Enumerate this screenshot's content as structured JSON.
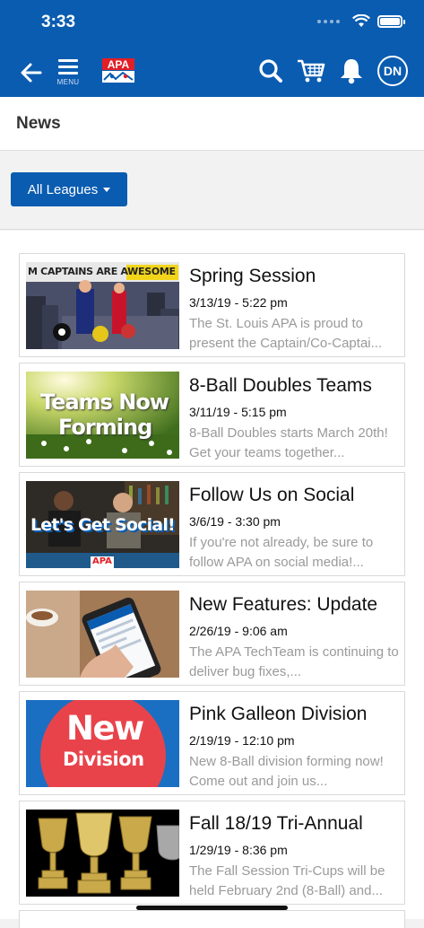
{
  "status": {
    "time": "3:33"
  },
  "nav": {
    "menu_label": "MENU",
    "logo_text": "APA",
    "avatar_initials": "DN"
  },
  "page": {
    "title": "News"
  },
  "filter": {
    "label": "All Leagues"
  },
  "thumbnails": {
    "spring": "M CAPTAINS ARE AWESOME",
    "teams_line1": "Teams Now",
    "teams_line2": "Forming",
    "social": "Let's Get Social!",
    "pink_line1": "New",
    "pink_line2": "Division",
    "social_badge": "APA"
  },
  "news": [
    {
      "title": "Spring Session",
      "date": "3/13/19 - 5:22 pm",
      "desc": "The St. Louis APA is proud to present the Captain/Co-Captai..."
    },
    {
      "title": "8-Ball Doubles Teams",
      "date": "3/11/19 - 5:15 pm",
      "desc": "8-Ball Doubles starts March 20th! Get your teams together..."
    },
    {
      "title": "Follow Us on Social",
      "date": "3/6/19 - 3:30 pm",
      "desc": "If you're not already, be sure to follow APA on social media!..."
    },
    {
      "title": "New Features: Update",
      "date": "2/26/19 - 9:06 am",
      "desc": "The APA TechTeam is continuing to deliver bug fixes,..."
    },
    {
      "title": "Pink Galleon Division",
      "date": "2/19/19 - 12:10 pm",
      "desc": "New 8-Ball division forming now! Come out and join us..."
    },
    {
      "title": "Fall 18/19 Tri-Annual",
      "date": "1/29/19 - 8:36 pm",
      "desc": "The Fall Session Tri-Cups will be held February 2nd (8-Ball) and..."
    }
  ],
  "colors": {
    "brand_blue": "#0a5cb0",
    "desc_gray": "#9a9a9a",
    "pink_red": "#e8434b"
  }
}
